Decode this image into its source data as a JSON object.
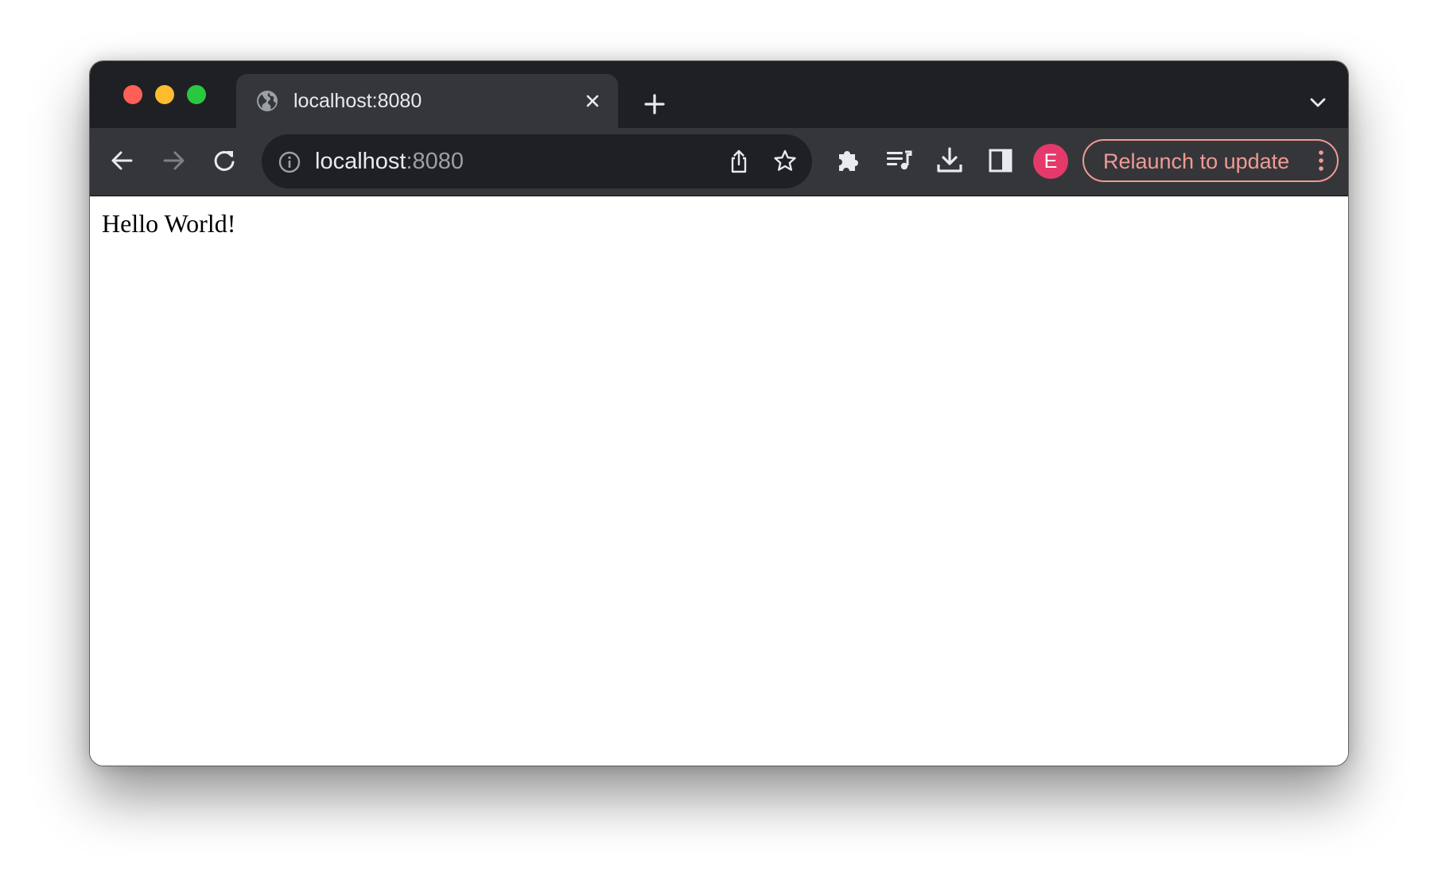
{
  "colors": {
    "tabstrip_bg": "#1f2023",
    "toolbar_bg": "#35363a",
    "omnibox_bg": "#1f2023",
    "traffic_red": "#fe5f57",
    "traffic_yellow": "#febc2e",
    "traffic_green": "#28c840",
    "accent_relaunch": "#f19a94",
    "avatar_bg": "#e5396b"
  },
  "tab": {
    "title": "localhost:8080",
    "favicon_icon": "globe-icon",
    "close_icon": "close-icon"
  },
  "tabstrip": {
    "new_tab_icon": "plus-icon",
    "tab_search_icon": "chevron-down-icon"
  },
  "toolbar": {
    "back_icon": "arrow-left-icon",
    "forward_icon": "arrow-right-icon",
    "reload_icon": "reload-icon",
    "extensions_icon": "puzzle-icon",
    "media_icon": "queue-music-icon",
    "downloads_icon": "download-icon",
    "side_panel_icon": "side-panel-icon",
    "avatar_initial": "E",
    "relaunch_label": "Relaunch to update",
    "menu_icon": "kebab-menu-icon"
  },
  "omnibox": {
    "host": "localhost",
    "port": ":8080",
    "info_icon": "info-icon",
    "share_icon": "share-icon",
    "bookmark_icon": "star-icon"
  },
  "page": {
    "body_text": "Hello World!"
  }
}
